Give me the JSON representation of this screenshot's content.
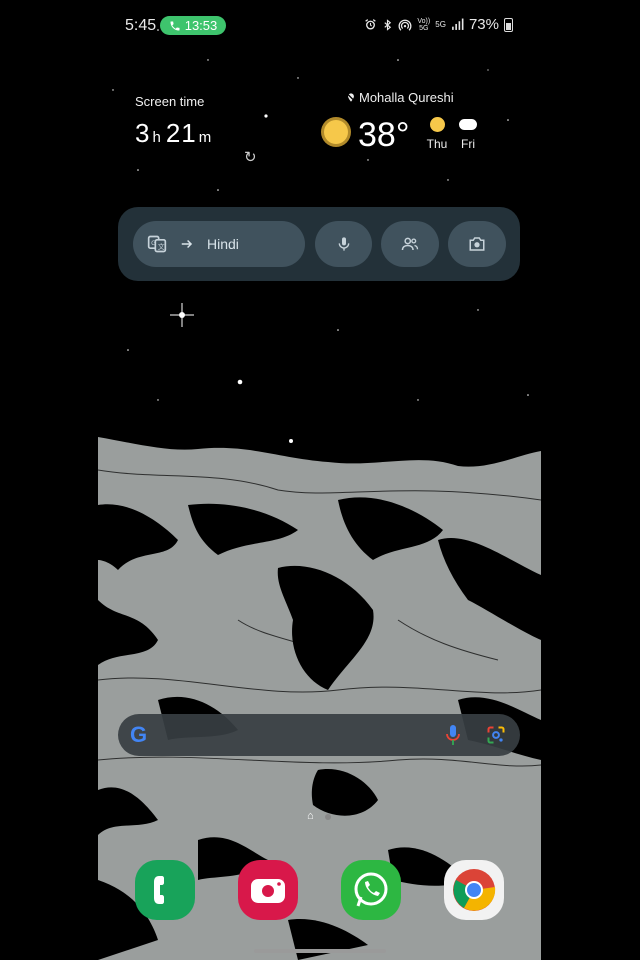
{
  "status_bar": {
    "time": "5:45",
    "call_duration": "13:53",
    "battery": "73%",
    "network_labels": {
      "volte": "Vo)) 5G",
      "data": "5G"
    },
    "icons": [
      "alarm-icon",
      "bluetooth-icon",
      "hotspot-icon",
      "volte-icon",
      "data-5g-icon",
      "signal-icon",
      "battery-icon"
    ]
  },
  "screen_time": {
    "label": "Screen time",
    "hours": "3",
    "hours_unit": "h",
    "minutes": "21",
    "minutes_unit": "m"
  },
  "weather": {
    "location": "Mohalla Qureshi",
    "temperature": "38°",
    "forecast": [
      {
        "day": "Thu",
        "icon": "sun-icon"
      },
      {
        "day": "Fri",
        "icon": "partly-cloudy-icon"
      }
    ]
  },
  "quick_widget": {
    "translate_target": "Hindi",
    "buttons": [
      "translate-button",
      "voice-button",
      "conversation-button",
      "camera-translate-button"
    ]
  },
  "search_bar": {
    "logo": "G"
  },
  "dock": [
    {
      "name": "Phone",
      "color": "#18a35a"
    },
    {
      "name": "Camera",
      "color": "#d8184a"
    },
    {
      "name": "WhatsApp",
      "color": "#2db742"
    },
    {
      "name": "Chrome",
      "color": "#f2f2f2"
    }
  ]
}
